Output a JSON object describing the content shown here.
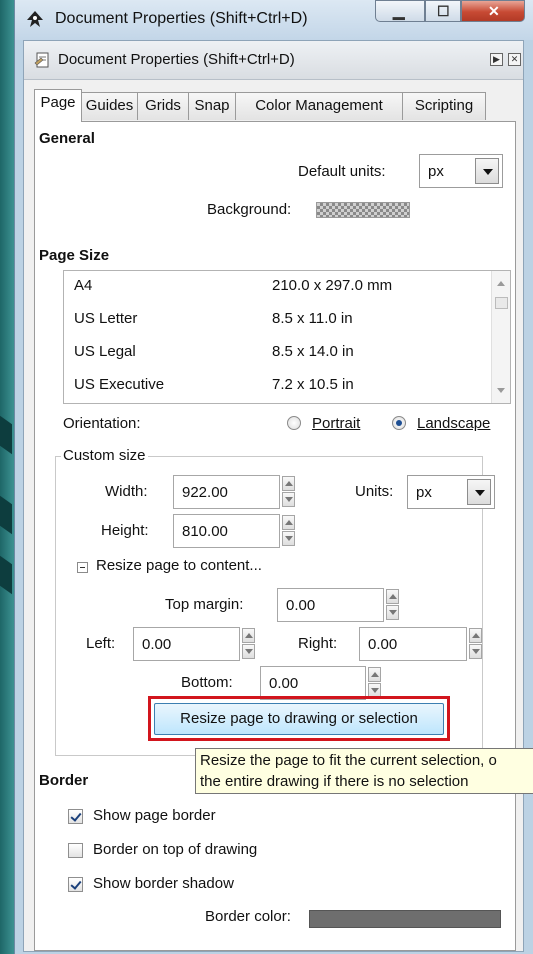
{
  "window": {
    "title": "Document Properties (Shift+Ctrl+D)",
    "minimize_glyph": "▁",
    "maximize_glyph": "☐",
    "close_glyph": "✕"
  },
  "dock": {
    "title": "Document Properties (Shift+Ctrl+D)",
    "pin_glyph": "▶",
    "close_glyph": "✕"
  },
  "tabs": [
    "Page",
    "Guides",
    "Grids",
    "Snap",
    "Color Management",
    "Scripting"
  ],
  "general": {
    "heading": "General",
    "default_units_label": "Default units:",
    "default_units_value": "px",
    "background_label": "Background:"
  },
  "page_size": {
    "heading": "Page Size",
    "rows": [
      {
        "name": "A4",
        "size": "210.0 x 297.0 mm"
      },
      {
        "name": "US Letter",
        "size": "8.5 x 11.0 in"
      },
      {
        "name": "US Legal",
        "size": "8.5 x 14.0 in"
      },
      {
        "name": "US Executive",
        "size": "7.2 x 10.5 in"
      }
    ],
    "orientation_label": "Orientation:",
    "portrait_label": "Portrait",
    "landscape_label": "Landscape",
    "orientation_selected": "Landscape"
  },
  "custom_size": {
    "legend": "Custom size",
    "width_label": "Width:",
    "width_value": "922.00",
    "height_label": "Height:",
    "height_value": "810.00",
    "units_label": "Units:",
    "units_value": "px"
  },
  "resize": {
    "expander_label": "Resize page to content...",
    "top_margin_label": "Top margin:",
    "top_margin_value": "0.00",
    "left_label": "Left:",
    "left_value": "0.00",
    "right_label": "Right:",
    "right_value": "0.00",
    "bottom_label": "Bottom:",
    "bottom_value": "0.00",
    "button_label": "Resize page to drawing or selection",
    "tooltip_line1": "Resize the page to fit the current selection, o",
    "tooltip_line2": "the entire drawing if there is no selection"
  },
  "border": {
    "heading": "Border",
    "show_page_border_label": "Show page border",
    "show_page_border_checked": true,
    "border_on_top_label": "Border on top of drawing",
    "border_on_top_checked": false,
    "show_border_shadow_label": "Show border shadow",
    "show_border_shadow_checked": true,
    "border_color_label": "Border color:",
    "border_color": "#6e6e6e"
  },
  "colors": {
    "desktop": "#2f7f80",
    "highlight_box": "#d2151d",
    "tooltip_bg": "#ffffe1"
  }
}
